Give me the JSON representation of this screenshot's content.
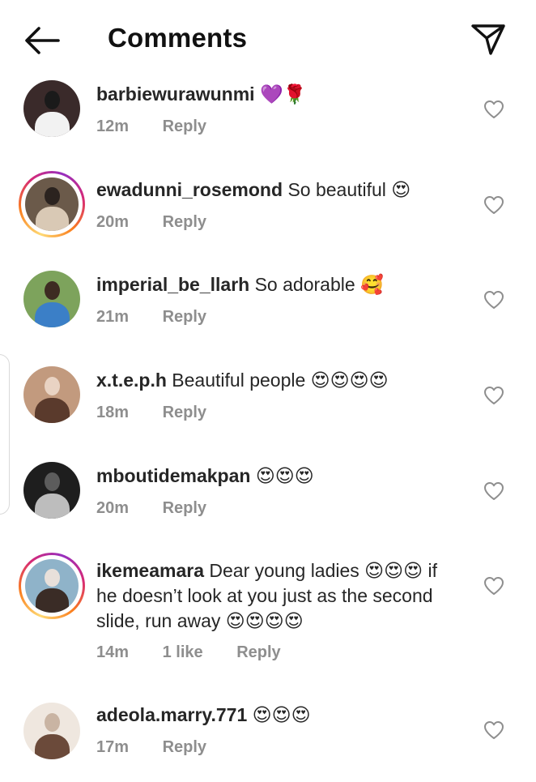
{
  "header": {
    "title": "Comments"
  },
  "comments": [
    {
      "username": "barbiewurawunmi",
      "text": "💜🌹",
      "time": "12m",
      "likes": "",
      "reply": "Reply",
      "story_ring": false,
      "avatar_colors": [
        "#3a2a2a",
        "#f2f2f2",
        "#1a1a1a"
      ]
    },
    {
      "username": "ewadunni_rosemond",
      "text": "So beautiful 😍",
      "time": "20m",
      "likes": "",
      "reply": "Reply",
      "story_ring": true,
      "avatar_colors": [
        "#6b5a4a",
        "#d9c9b5",
        "#2b231f"
      ]
    },
    {
      "username": "imperial_be_llarh",
      "text": "So adorable 🥰",
      "time": "21m",
      "likes": "",
      "reply": "Reply",
      "story_ring": false,
      "avatar_colors": [
        "#7da35c",
        "#3b7fc7",
        "#3d2b22"
      ]
    },
    {
      "username": "x.t.e.p.h",
      "text": "Beautiful people 😍😍😍😍",
      "time": "18m",
      "likes": "",
      "reply": "Reply",
      "story_ring": false,
      "avatar_colors": [
        "#c29a7e",
        "#5a3a2c",
        "#e9d3c3"
      ]
    },
    {
      "username": "mboutidemakpan",
      "text": "😍😍😍",
      "time": "20m",
      "likes": "",
      "reply": "Reply",
      "story_ring": false,
      "avatar_colors": [
        "#1e1e1e",
        "#bdbdbd",
        "#5c5c5c"
      ]
    },
    {
      "username": "ikemeamara",
      "text": "Dear young ladies 😍😍😍 if he doesn’t look at you just as the second slide, run away 😍😍😍😍",
      "time": "14m",
      "likes": "1 like",
      "reply": "Reply",
      "story_ring": true,
      "avatar_colors": [
        "#8fb3c9",
        "#3a2c26",
        "#e8e0da"
      ]
    },
    {
      "username": "adeola.marry.771",
      "text": "😍😍😍",
      "time": "17m",
      "likes": "",
      "reply": "Reply",
      "story_ring": false,
      "avatar_colors": [
        "#efe7df",
        "#6b4a3a",
        "#c9b4a3"
      ]
    }
  ]
}
